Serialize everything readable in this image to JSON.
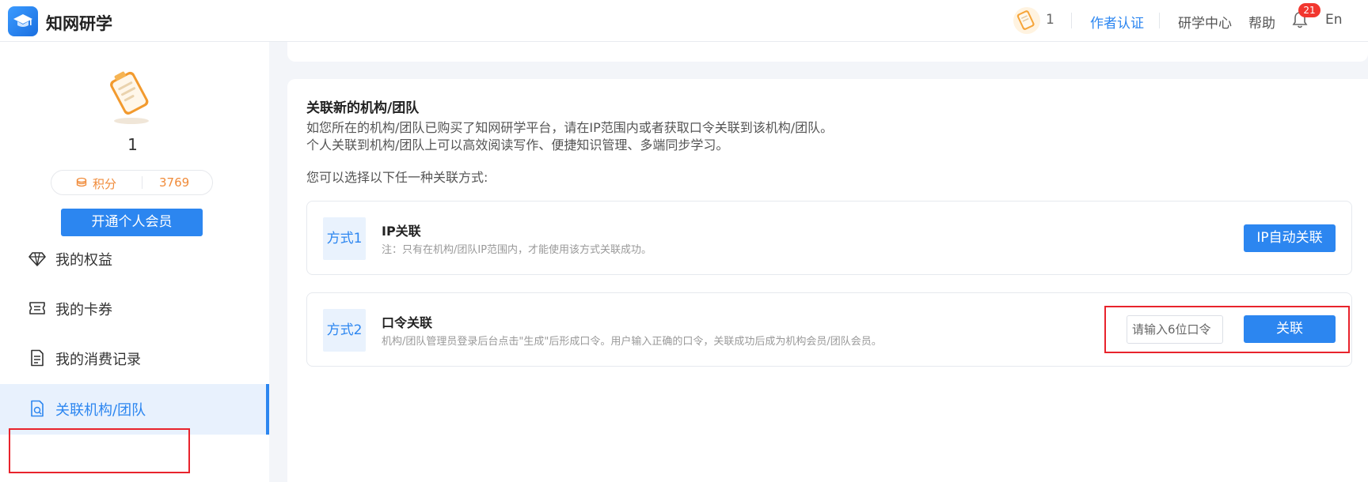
{
  "header": {
    "brand": "知网研学",
    "user_name": "1",
    "links": {
      "author_cert": "作者认证",
      "research_center": "研学中心",
      "help": "帮助",
      "lang": "En"
    },
    "notification_count": "21",
    "accent": "#2c86f0"
  },
  "sidebar": {
    "user_name": "1",
    "points_label": "积分",
    "points_value": "3769",
    "vip_button": "开通个人会员",
    "items": [
      {
        "label": "我的权益",
        "icon": "diamond-icon"
      },
      {
        "label": "我的卡券",
        "icon": "ticket-icon"
      },
      {
        "label": "我的消费记录",
        "icon": "document-icon"
      },
      {
        "label": "关联机构/团队",
        "icon": "link-document-icon",
        "active": true
      }
    ]
  },
  "main": {
    "title": "关联新的机构/团队",
    "desc1": "如您所在的机构/团队已购买了知网研学平台，请在IP范围内或者获取口令关联到该机构/团队。",
    "desc2": "个人关联到机构/团队上可以高效阅读写作、便捷知识管理、多端同步学习。",
    "choose": "您可以选择以下任一种关联方式:",
    "methods": [
      {
        "tag": "方式1",
        "title": "IP关联",
        "note": "注：只有在机构/团队IP范围内，才能使用该方式关联成功。",
        "button": "IP自动关联"
      },
      {
        "tag": "方式2",
        "title": "口令关联",
        "note": "机构/团队管理员登录后台点击\"生成\"后形成口令。用户输入正确的口令，关联成功后成为机构会员/团队会员。",
        "input_placeholder": "请输入6位口令",
        "input_value": "",
        "button": "关联"
      }
    ]
  }
}
